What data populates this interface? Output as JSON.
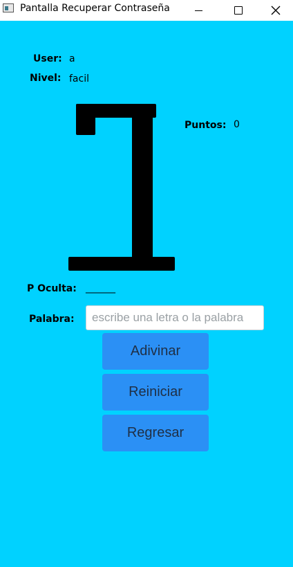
{
  "window": {
    "title": "Pantalla Recuperar Contraseña"
  },
  "labels": {
    "user": "User:",
    "nivel": "Nivel:",
    "puntos": "Puntos:",
    "oculta": "P Oculta:",
    "palabra": "Palabra:"
  },
  "values": {
    "user": "a",
    "nivel": "facil",
    "puntos": "0",
    "oculta": "_______"
  },
  "input": {
    "placeholder": "escribe una letra o la palabra",
    "value": ""
  },
  "buttons": {
    "adivinar": "Adivinar",
    "reiniciar": "Reiniciar",
    "regresar": "Regresar"
  },
  "colors": {
    "background": "#00d2ff",
    "button": "#2b90f5",
    "button_text": "#1f2f45",
    "gallows": "#000000"
  },
  "icons": {
    "app": "app-window-icon",
    "minimize": "minimize-icon",
    "maximize": "maximize-icon",
    "close": "close-icon"
  }
}
